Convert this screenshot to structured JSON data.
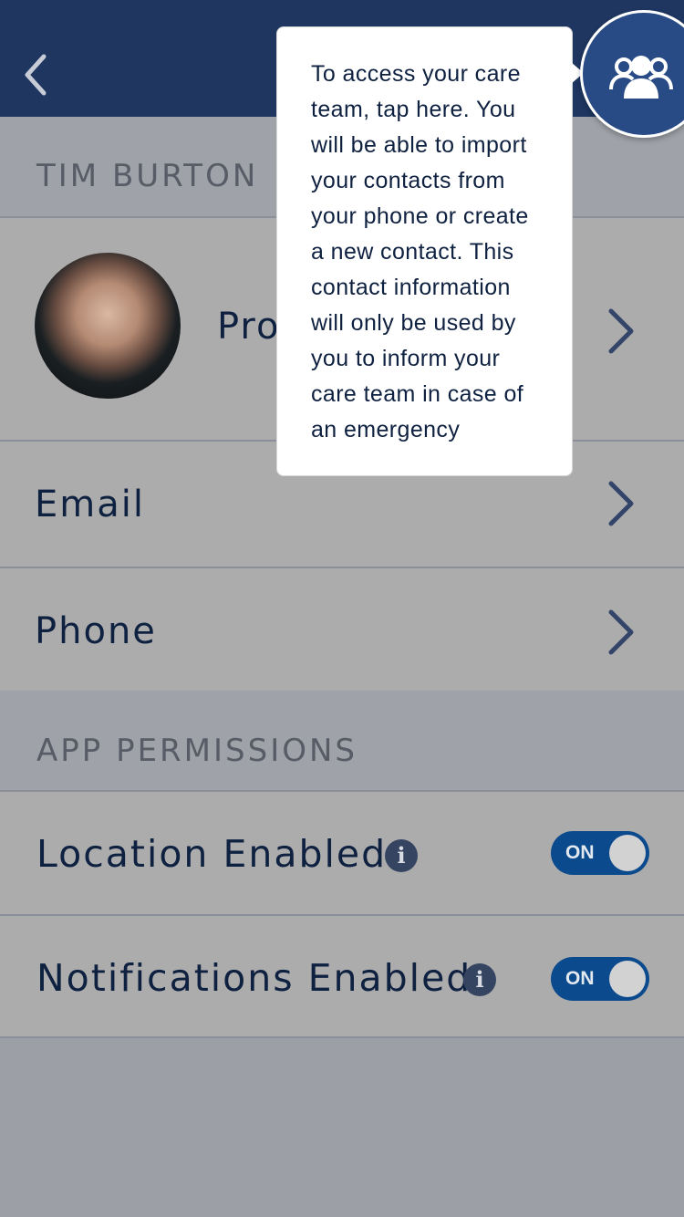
{
  "header": {
    "back_icon": "chevron-left-icon",
    "care_team_icon": "group-icon",
    "background": "#1e3660"
  },
  "profile_section": {
    "title": "TIM BURTON",
    "profile_row_label": "Profile",
    "email_label": "Email",
    "phone_label": "Phone"
  },
  "permissions_section": {
    "title": "APP PERMISSIONS",
    "location_label": "Location Enabled",
    "location_toggle": "ON",
    "notifications_label": "Notifications Enabled",
    "notifications_toggle": "ON"
  },
  "tooltip": {
    "lines": [
      "To access your care",
      "team, tap here. You",
      "will be able to import",
      "your contacts from",
      "your phone or create",
      "a new contact. This",
      "contact information",
      "will only be used by",
      "you to inform your",
      "care team in case of",
      "an emergency"
    ]
  },
  "colors": {
    "accent": "#0b4a8d",
    "text": "#0f2140",
    "overlay": "#acacac"
  }
}
